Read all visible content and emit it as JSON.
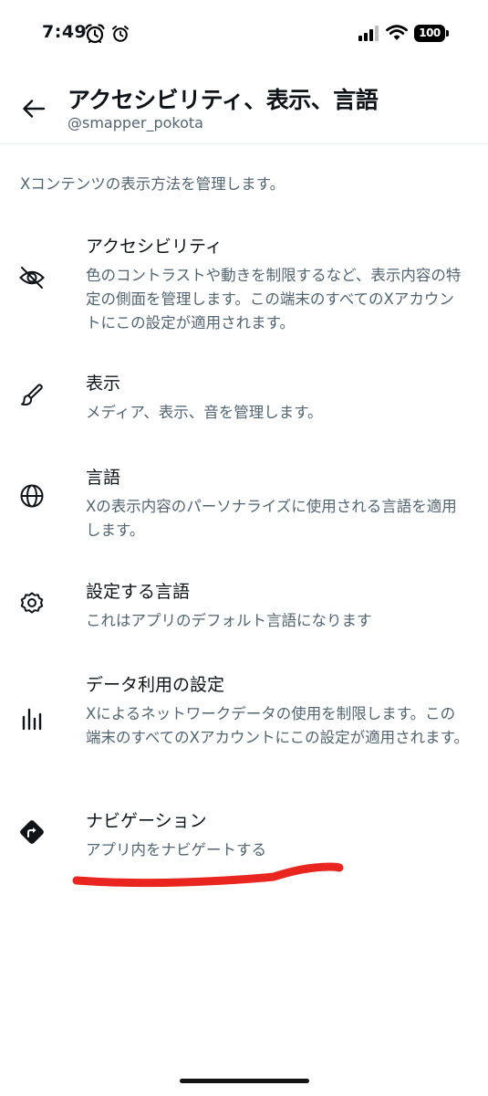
{
  "status_bar": {
    "time": "7:49",
    "battery": "100"
  },
  "header": {
    "title": "アクセシビリティ、表示、言語",
    "subtitle": "@smapper_pokota"
  },
  "description": "Xコンテンツの表示方法を管理します。",
  "menu": [
    {
      "icon": "eye-slash-icon",
      "title": "アクセシビリティ",
      "desc": "色のコントラストや動きを制限するなど、表示内容の特定の側面を管理します。この端末のすべてのXアカウントにこの設定が適用されます。"
    },
    {
      "icon": "brush-icon",
      "title": "表示",
      "desc": "メディア、表示、音を管理します。"
    },
    {
      "icon": "globe-icon",
      "title": "言語",
      "desc": "Xの表示内容のパーソナライズに使用される言語を適用します。"
    },
    {
      "icon": "gear-icon",
      "title": "設定する言語",
      "desc": "これはアプリのデフォルト言語になります"
    },
    {
      "icon": "bar-chart-icon",
      "title": "データ利用の設定",
      "desc": "Xによるネットワークデータの使用を制限します。この端末のすべてのXアカウントにこの設定が適用されます。"
    },
    {
      "icon": "directions-icon",
      "title": "ナビゲーション",
      "desc": "アプリ内をナビゲートする"
    }
  ],
  "colors": {
    "text_primary": "#0f1419",
    "text_secondary": "#536471",
    "annotation": "#e8261f"
  }
}
